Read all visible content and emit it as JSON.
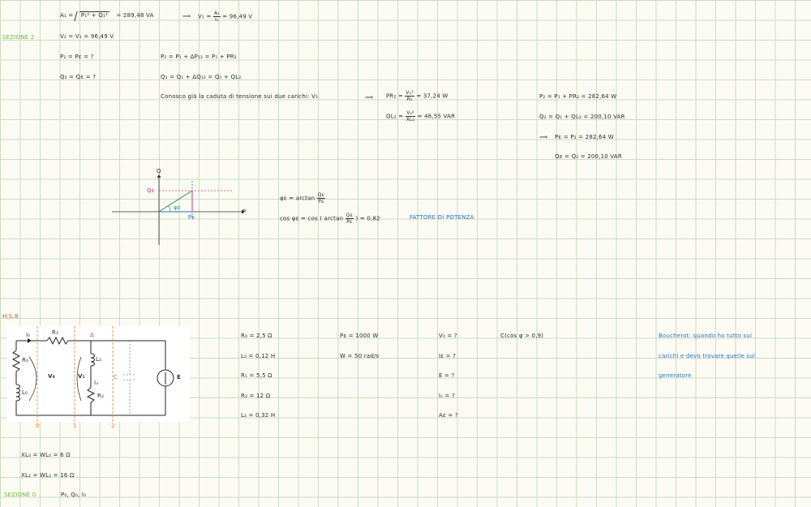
{
  "notes": {
    "a1_lhs": "A₁ = ",
    "a1_radicand": "P₁² + Q₁²",
    "a1_result": "= 289,48 VA",
    "implies1": "⟹",
    "v1_lhs": "V₁ =",
    "v1_num": "A₁",
    "v1_den": "I₁",
    "v1_result": "= 96,49 V",
    "sezione2": "SEZIONE 2",
    "v2_eq": "V₂ = V₁ = 96,49 V",
    "p2_eq": "P₂ = Pɛ = ?",
    "q2_eq": "Q₂ = Qɛ = ?",
    "p2_balance": "P₂ = P₁ + ΔP₁₂ = P₁ + PR₂",
    "q2_balance": "Q₂ = Q₁ + ΔQ₁₂ = Q₁ + QL₂",
    "conosco": "Conosco già la caduta di tensione sui due carichi: V₂",
    "implies2": "⟹",
    "pr2_lhs": "PR₂ =",
    "pr2_num": "V₂²",
    "pr2_den": "R₂",
    "pr2_result": "= 37,24 W",
    "ql2_lhs": "QL₂ =",
    "ql2_num": "V₂²",
    "ql2_den": "XL₂",
    "ql2_result": "= 46,55 VAR",
    "p2_value": "P₂ = P₁ + PR₂ = 282,64 W",
    "q2_value": "Q₂ = Q₁ + QL₂ = 200,10 VAR",
    "implies3": "⟹",
    "pe_value": "Pɛ = P₂ = 282,64 W",
    "qe_value": "Qɛ = Q₂ = 200,10 VAR",
    "phi_lhs": "φɛ = arctan",
    "phi_num": "Qɛ",
    "phi_den": "Pɛ",
    "cos_lhs": "cos φɛ = cos ( arctan",
    "cos_num": "Qɛ",
    "cos_den": "Pɛ",
    "cos_rhs": ") = 0,82",
    "fattore": "FATTORE DI POTENZA",
    "diagram_q": "Q",
    "diagram_p": "P",
    "diagram_qe": "Qɛ",
    "diagram_pe": "Pɛ",
    "diagram_phi": "φɛ",
    "hs8": "H.S.8",
    "r0": "R₀ = 2,5 Ω",
    "l0": "L₀ = 0,12 H",
    "r1": "R₁ = 5,5 Ω",
    "r2": "R₂ = 12 Ω",
    "l2": "L₂ = 0,32 H",
    "pe_given": "Pɛ = 1000 W",
    "omega": "W = 50 rad/s",
    "v0_q": "V₀ = ?",
    "ie_q": "Iɛ = ?",
    "e_q": "E = ?",
    "is_q": "Iₛ = ?",
    "ae_q": "Aɛ = ?",
    "cond": "C(cos φ > 0,9)",
    "boucherot1": "Boucherot: quando ho tutto sui",
    "boucherot2": "carichi e devo trovare quelle sul",
    "boucherot3": "generatore",
    "xl0": "XL₀ = WL₀ = 6 Ω",
    "xl2": "XL₂ = WL₂ = 16 Ω",
    "sezione0": "SEZIONE 0",
    "sezione0_items": "P₀, Q₀, I₀",
    "circuit": {
      "I0": "I₀",
      "R1": "R₁",
      "R0": "R₀",
      "L0": "L₀",
      "V0": "V₀",
      "V1": "V₁",
      "Ix": "Iₓ",
      "L2": "L₂",
      "R2": "R₂",
      "C": "C",
      "E": "E",
      "n0": "0",
      "n1": "1",
      "n2": "2",
      "delta": "Δ"
    }
  },
  "colors": {
    "green": "#7cb342",
    "red": "#d84a3a",
    "blue": "#2b6fc7",
    "magenta": "#d6338b",
    "orange": "#e8742a"
  }
}
